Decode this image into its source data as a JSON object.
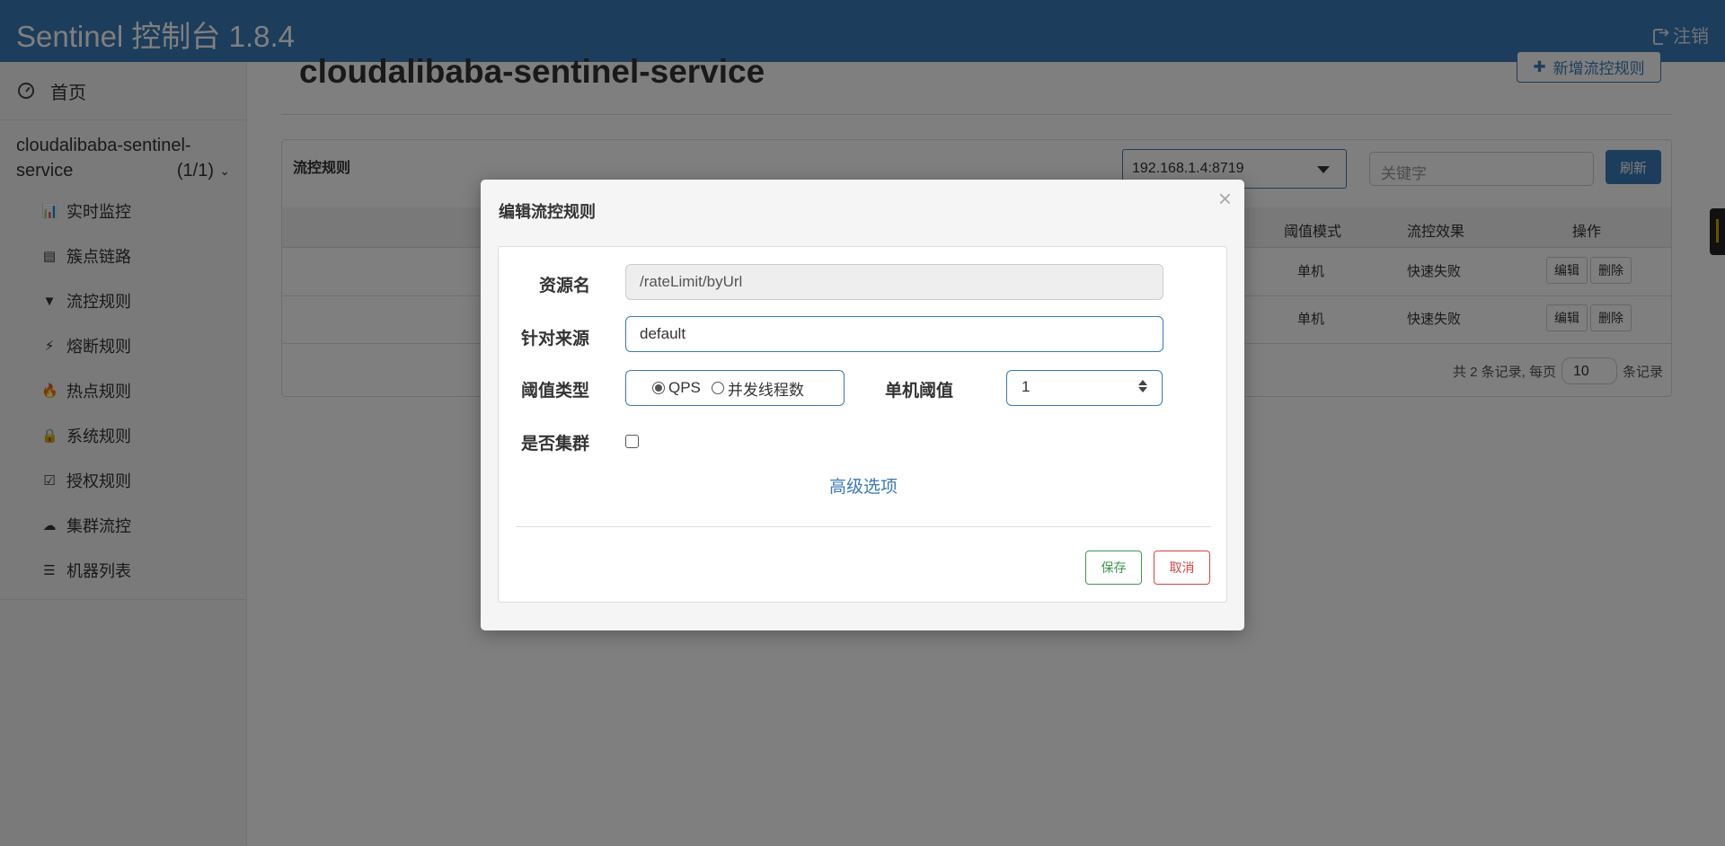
{
  "app": {
    "title": "Sentinel 控制台 1.8.4",
    "logout_label": "注销"
  },
  "sidebar": {
    "home_label": "首页",
    "app_name_line1": "cloudalibaba-sentinel-",
    "app_name_line2": "service",
    "app_count": "(1/1)",
    "items": [
      {
        "label": "实时监控",
        "icon": "bar-chart-icon"
      },
      {
        "label": "簇点链路",
        "icon": "list-alt-icon"
      },
      {
        "label": "流控规则",
        "icon": "filter-icon"
      },
      {
        "label": "熔断规则",
        "icon": "flash-icon"
      },
      {
        "label": "热点规则",
        "icon": "fire-icon"
      },
      {
        "label": "系统规则",
        "icon": "lock-icon"
      },
      {
        "label": "授权规则",
        "icon": "check-icon"
      },
      {
        "label": "集群流控",
        "icon": "cloud-icon"
      },
      {
        "label": "机器列表",
        "icon": "th-list-icon"
      }
    ]
  },
  "main": {
    "title": "cloudalibaba-sentinel-service",
    "add_rule_label": "新增流控规则",
    "panel_title": "流控规则",
    "machine_select": "192.168.1.4:8719",
    "keyword_placeholder": "关键字",
    "refresh_label": "刷新",
    "columns": [
      "阈值模式",
      "流控效果",
      "操作"
    ],
    "rows": [
      {
        "mode": "单机",
        "effect": "快速失败",
        "edit": "编辑",
        "delete": "删除"
      },
      {
        "mode": "单机",
        "effect": "快速失败",
        "edit": "编辑",
        "delete": "删除"
      }
    ],
    "pager_text": "共 2 条记录, 每页",
    "page_size": "10",
    "pager_suffix": "条记录"
  },
  "modal": {
    "title": "编辑流控规则",
    "close": "×",
    "resource_label": "资源名",
    "resource_value": "/rateLimit/byUrl",
    "origin_label": "针对来源",
    "origin_value": "default",
    "threshold_type_label": "阈值类型",
    "threshold_type_options": [
      "QPS",
      "并发线程数"
    ],
    "threshold_type_selected": "QPS",
    "single_threshold_label": "单机阈值",
    "single_threshold_value": "1",
    "cluster_label": "是否集群",
    "cluster_checked": false,
    "advanced_label": "高级选项",
    "save_label": "保存",
    "cancel_label": "取消"
  },
  "colors": {
    "primary": "#3a7ab8",
    "success": "#3c9a48",
    "danger": "#d9433f"
  }
}
